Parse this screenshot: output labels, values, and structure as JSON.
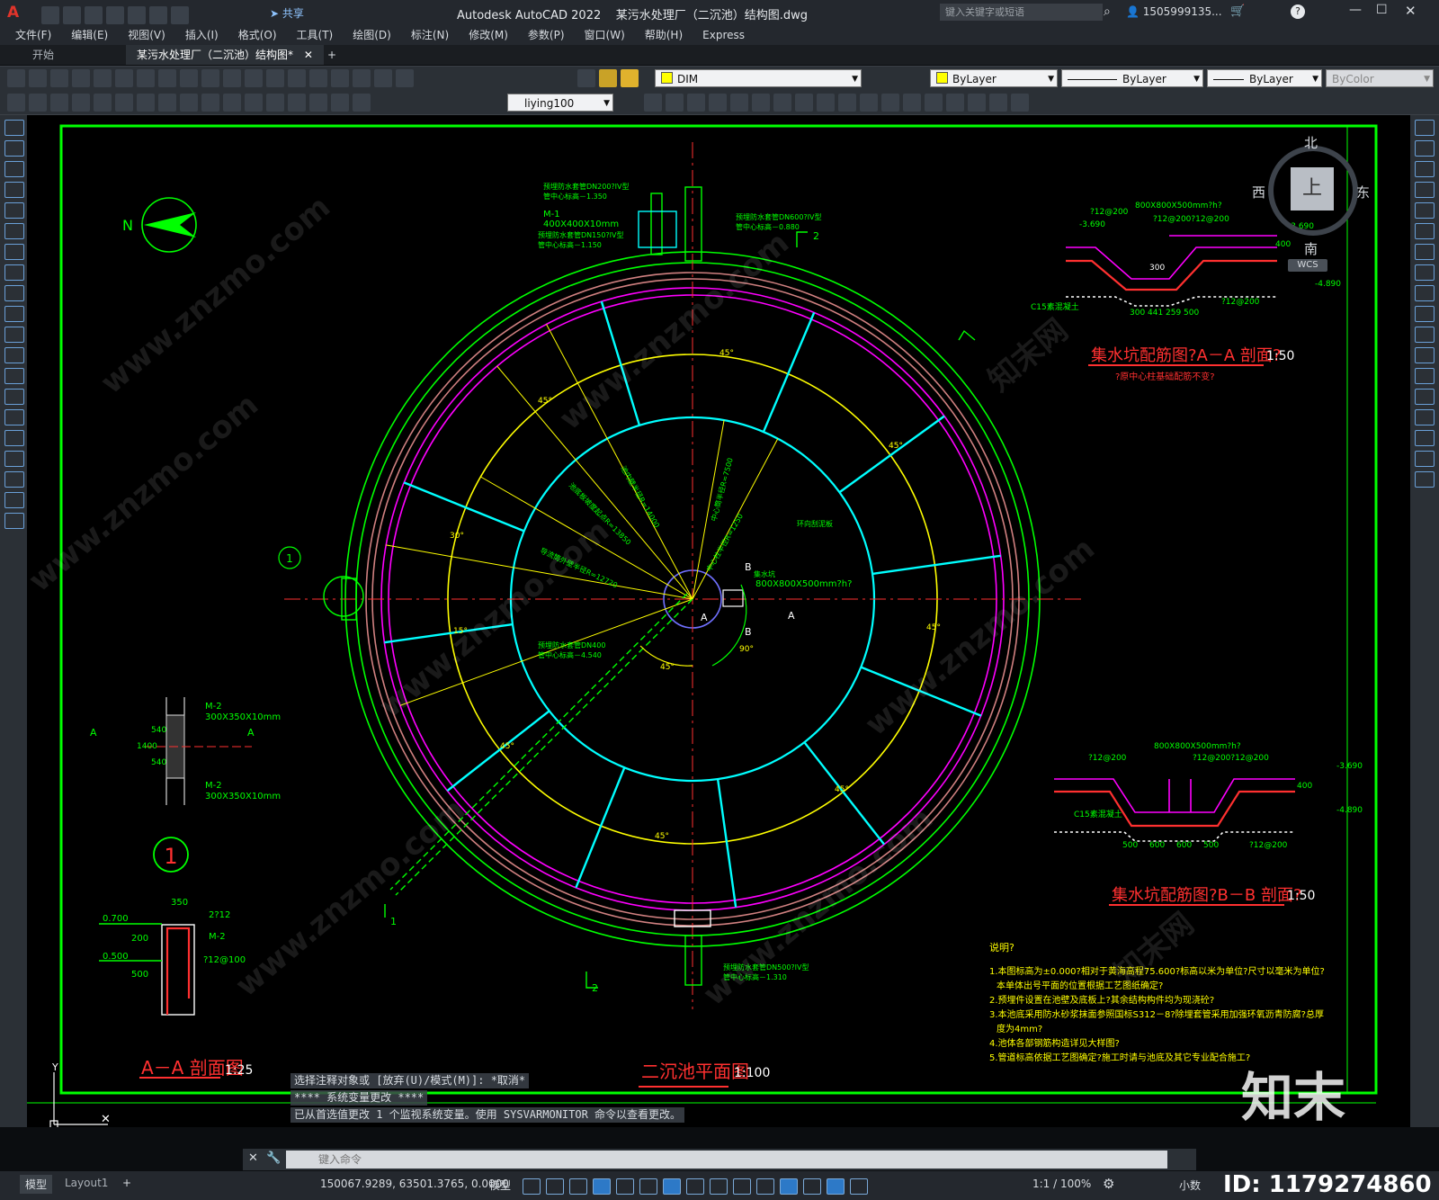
{
  "app": {
    "title": "Autodesk AutoCAD 2022    某污水处理厂（二沉池）结构图.dwg",
    "search_placeholder": "键入关键字或短语",
    "user": "1505999135...",
    "share": "共享"
  },
  "menu": [
    "文件(F)",
    "编辑(E)",
    "视图(V)",
    "插入(I)",
    "格式(O)",
    "工具(T)",
    "绘图(D)",
    "标注(N)",
    "修改(M)",
    "参数(P)",
    "窗口(W)",
    "帮助(H)",
    "Express"
  ],
  "tabs": [
    {
      "label": "开始"
    },
    {
      "label": "某污水处理厂（二沉池）结构图*"
    }
  ],
  "toolbar": {
    "dimstyle": "DIM",
    "layer": "ByLayer",
    "linetype": "ByLayer",
    "lineweight": "ByLayer",
    "color": "ByColor",
    "textstyle": "liying100"
  },
  "viewcube": {
    "north": "北",
    "south": "南",
    "east": "东",
    "west": "西",
    "top": "上",
    "wcs": "WCS"
  },
  "drawing": {
    "plan_title": "二沉池平面图",
    "plan_scale": "1:100",
    "section_aa_title": "A－A 剖面图",
    "section_aa_scale": "1:25",
    "sump_a_title": "集水坑配筋图?A－A 剖面?",
    "sump_a_scale": "1:50",
    "sump_a_note": "?原中心柱基础配筋不变?",
    "sump_b_title": "集水坑配筋图?B－B 剖面?",
    "sump_b_scale": "1:50",
    "sump_size": "800X800X500mm?h?",
    "sump_size_top": "800X800X500mm?h?",
    "rebar_212_200": "?12@200",
    "rebar_212_200b": "?12@200?12@200",
    "elev_n3690": "-3.690",
    "elev_n4890": "-4.890",
    "elev_0700": "0.700",
    "elev_0500": "0.500",
    "c15": "C15素混凝土",
    "m1": "M-1",
    "m1_size": "400X400X10mm",
    "m2": "M-2",
    "m2_size": "300X350X10mm",
    "dn200": "预埋防水套管DN200?IV型",
    "dn200_elev": "管中心标高－1.350",
    "dn150": "预埋防水套管DN150?IV型",
    "dn150_elev": "管中心标高－1.150",
    "dn600": "预埋防水套管DN600?IV型",
    "dn600_elev": "管中心标高－0.880",
    "dn400": "预埋防水套管DN400",
    "dn400_elev": "管中心标高－4.540",
    "dn500": "预埋防水套管DN500?IV型",
    "dn500_elev": "管中心标高－1.310",
    "sump_label": "集水坑",
    "platform_label": "环向刮泥板",
    "angle_45": "45°",
    "angle_90": "90°",
    "angle_30": "30°",
    "angle_15": "15°",
    "r_14000": "池内壁半径R=14000",
    "r_13850": "池底板坡度起点R=13850",
    "r_12720": "导流筒外壁半径R=12720",
    "r_7500": "中心筒半径R=7500",
    "r_1250": "中心柱半径R=1250",
    "label_a": "A",
    "label_b": "B",
    "label_1": "1",
    "label_2": "2",
    "dim_350": "350",
    "dim_540": "540",
    "dim_1400": "1400",
    "dim_200": "200",
    "dim_500": "500",
    "dim_400": "400",
    "dim_300": "300",
    "dim_441": "441",
    "dim_259": "259",
    "dim_600": "600",
    "rebar_2f12": "2?12",
    "rebar_f12_100": "?12@100",
    "notes_title": "说明?",
    "notes": [
      "1.本图标高为±0.000?相对于黄海高程75.600?标高以米为单位?尺寸以毫米为单位?",
      "   本单体出号平面的位置根据工艺图纸确定?",
      "2.预埋件设置在池壁及底板上?其余结构构件均为现浇砼?",
      "3.本池底采用防水砂浆抹面参照国标S312－8?除埋套管采用加强环氧沥青防腐?总厚",
      "   度为4mm?",
      "4.池体各部钢筋构造详见大样图?",
      "5.管道标高依据工艺图确定?施工时请与池底及其它专业配合施工?"
    ]
  },
  "command": {
    "history": [
      "选择注释对象或 [放弃(U)/模式(M)]: *取消*",
      "**** 系统变量更改 ****",
      "已从首选值更改 1 个监视系统变量。使用 SYSVARMONITOR 命令以查看更改。"
    ],
    "placeholder": "键入命令"
  },
  "status": {
    "layouts": [
      "模型",
      "Layout1"
    ],
    "coords": "150067.9289, 63501.3765, 0.0000",
    "space": "模型",
    "scale": "1:1 / 100%",
    "units": "小数"
  },
  "watermark": {
    "brand": "知末",
    "id": "ID: 1179274860",
    "site": "www.znzmo.com",
    "site_cn": "知末网"
  }
}
